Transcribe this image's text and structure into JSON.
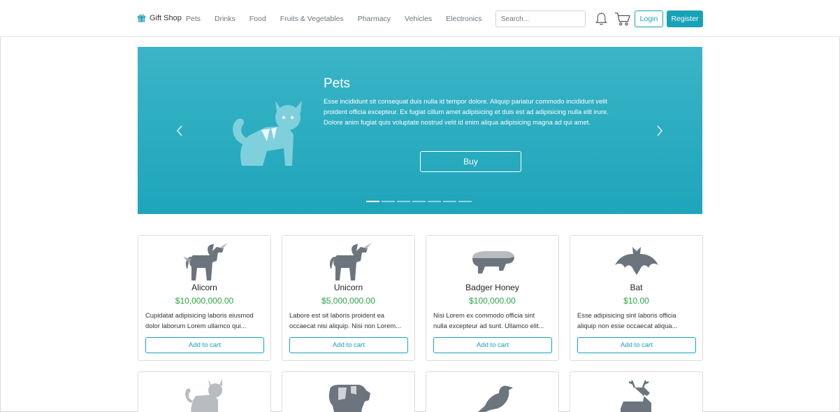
{
  "navbar": {
    "brand": "Gift Shop",
    "links": [
      "Pets",
      "Drinks",
      "Food",
      "Fruits & Vegetables",
      "Pharmacy",
      "Vehicles",
      "Electronics"
    ],
    "search_placeholder": "Search...",
    "login_label": "Login",
    "register_label": "Register",
    "icons": [
      "gift-icon",
      "bell-icon",
      "cart-icon"
    ]
  },
  "carousel": {
    "title": "Pets",
    "text": "Esse incididunt sit consequat duis nulla id tempor dolore. Aliquip pariatur commodo incididunt velit proident officia excepteur. Ex fugiat cillum amet adipisicing et duis est ad adipisicing nulla elit irure. Dolore anim fugiat quis voluptate nostrud velit id enim aliqua adipisicing magna ad qui amet.",
    "button_label": "Buy",
    "slide_count": 7,
    "active_slide": 1,
    "image_icon": "cat-icon"
  },
  "products": [
    {
      "name": "Alicorn",
      "price": "$10,000,000.00",
      "desc1": "Cupidatat adipisicing laboris eiusmod",
      "desc2": "dolor laborum Lorem ullamco qui...",
      "button": "Add to cart",
      "icon": "alicorn-icon"
    },
    {
      "name": "Unicorn",
      "price": "$5,000,000.00",
      "desc1": "Labore est sit laboris proident ea",
      "desc2": "occaecat nisi aliquip. Nisi non Lorem...",
      "button": "Add to cart",
      "icon": "unicorn-icon"
    },
    {
      "name": "Badger Honey",
      "price": "$100,000.00",
      "desc1": "Nisi Lorem ex commodo officia sint",
      "desc2": "nulla excepteur ad sunt. Ullamco elit...",
      "button": "Add to cart",
      "icon": "badger-icon"
    },
    {
      "name": "Bat",
      "price": "$10.00",
      "desc1": "Esse adipisicing sint laboris officia",
      "desc2": "aliquip non esse occaecat aliqua...",
      "button": "Add to cart",
      "icon": "bat-icon"
    }
  ],
  "products_row2_icons": [
    "cat-icon",
    "cow-icon",
    "crow-icon",
    "deer-icon"
  ],
  "colors": {
    "accent": "#17a2b8",
    "price": "#28a745",
    "icon_gray": "#6c757d"
  }
}
